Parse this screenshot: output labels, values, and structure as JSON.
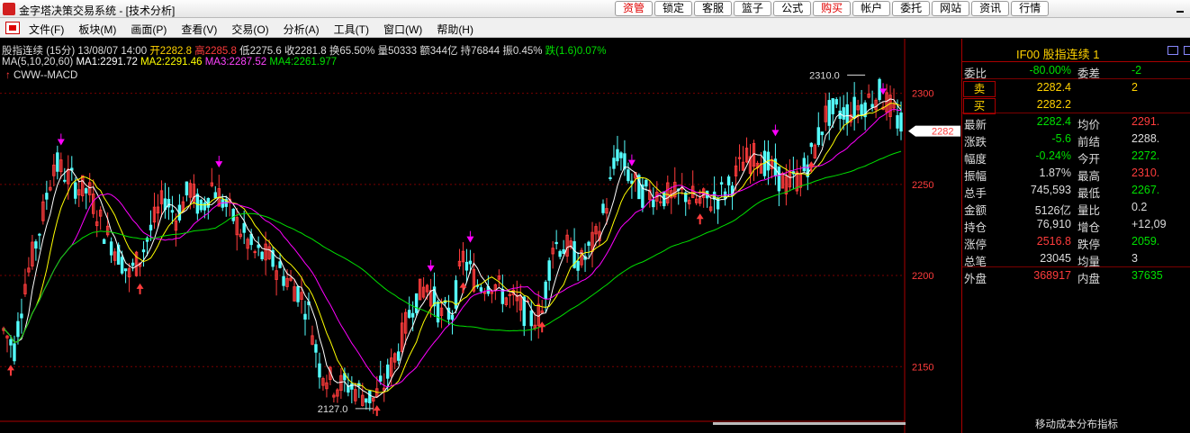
{
  "window": {
    "title": "金字塔决策交易系统 - [技术分析]"
  },
  "top_buttons": [
    {
      "label": "资管",
      "red": true
    },
    {
      "label": "锁定",
      "red": false
    },
    {
      "label": "客服",
      "red": false
    },
    {
      "label": "篮子",
      "red": false
    },
    {
      "label": "公式",
      "red": false
    },
    {
      "label": "购买",
      "red": true
    },
    {
      "label": "帐户",
      "red": false
    },
    {
      "label": "委托",
      "red": false
    },
    {
      "label": "网站",
      "red": false
    },
    {
      "label": "资讯",
      "red": false
    },
    {
      "label": "行情",
      "red": false
    }
  ],
  "menus": [
    "文件(F)",
    "板块(M)",
    "画面(P)",
    "查看(V)",
    "交易(O)",
    "分析(A)",
    "工具(T)",
    "窗口(W)",
    "帮助(H)"
  ],
  "info": {
    "name": "股指连续 (15分)",
    "datetime": "13/08/07 14:00",
    "open": "开2282.8",
    "high": "高2285.8",
    "low": "低2275.6",
    "close": "收2281.8",
    "turnover_rate": "换65.50%",
    "volume": "量50333",
    "amount": "额344亿",
    "open_interest": "持76844",
    "amplitude": "振0.45%",
    "change": "跌(1.6)0.07%",
    "ma_params": "MA(5,10,20,60)",
    "ma1": "MA1:2291.72",
    "ma2": "MA2:2291.46",
    "ma3": "MA3:2287.52",
    "ma4": "MA4:2261.977",
    "indicator": "CWW--MACD",
    "indicator_arrow": "↑"
  },
  "colors": {
    "up": "#ff3c3c",
    "down": "#54ffff",
    "ma1": "#ffffff",
    "ma2": "#ffff00",
    "ma3": "#ff00ff",
    "ma4": "#00e000",
    "grid": "#7a0000",
    "panel_green": "#00e000",
    "yellow": "#ffd200"
  },
  "chart_data": {
    "type": "candlestick",
    "x_range": [
      0,
      250
    ],
    "ylim": [
      2120,
      2325
    ],
    "yticks": [
      2150,
      2200,
      2250,
      2300
    ],
    "current_price_label": "2282",
    "annotations": [
      {
        "text": "2310.0",
        "x": 240,
        "y": 2310.0
      },
      {
        "text": "2127.0",
        "x": 103,
        "y": 2127.0
      }
    ],
    "anchors": [
      [
        0,
        2170
      ],
      [
        3,
        2160
      ],
      [
        6,
        2196
      ],
      [
        10,
        2225
      ],
      [
        14,
        2262
      ],
      [
        16,
        2258
      ],
      [
        20,
        2250
      ],
      [
        24,
        2245
      ],
      [
        28,
        2225
      ],
      [
        32,
        2212
      ],
      [
        35,
        2200
      ],
      [
        38,
        2210
      ],
      [
        42,
        2230
      ],
      [
        45,
        2243
      ],
      [
        48,
        2232
      ],
      [
        52,
        2248
      ],
      [
        55,
        2235
      ],
      [
        58,
        2250
      ],
      [
        62,
        2238
      ],
      [
        66,
        2225
      ],
      [
        70,
        2212
      ],
      [
        74,
        2210
      ],
      [
        78,
        2200
      ],
      [
        82,
        2192
      ],
      [
        85,
        2180
      ],
      [
        88,
        2150
      ],
      [
        92,
        2140
      ],
      [
        96,
        2140
      ],
      [
        100,
        2135
      ],
      [
        103,
        2132
      ],
      [
        106,
        2140
      ],
      [
        110,
        2160
      ],
      [
        114,
        2185
      ],
      [
        118,
        2195
      ],
      [
        122,
        2178
      ],
      [
        125,
        2180
      ],
      [
        128,
        2210
      ],
      [
        132,
        2195
      ],
      [
        136,
        2197
      ],
      [
        140,
        2188
      ],
      [
        143,
        2185
      ],
      [
        147,
        2176
      ],
      [
        150,
        2180
      ],
      [
        153,
        2218
      ],
      [
        157,
        2215
      ],
      [
        161,
        2207
      ],
      [
        165,
        2220
      ],
      [
        168,
        2240
      ],
      [
        171,
        2268
      ],
      [
        175,
        2252
      ],
      [
        178,
        2245
      ],
      [
        182,
        2245
      ],
      [
        186,
        2243
      ],
      [
        190,
        2245
      ],
      [
        194,
        2240
      ],
      [
        198,
        2242
      ],
      [
        202,
        2248
      ],
      [
        206,
        2262
      ],
      [
        210,
        2266
      ],
      [
        214,
        2258
      ],
      [
        218,
        2250
      ],
      [
        222,
        2254
      ],
      [
        226,
        2270
      ],
      [
        229,
        2288
      ],
      [
        232,
        2290
      ],
      [
        236,
        2290
      ],
      [
        240,
        2295
      ],
      [
        244,
        2300
      ],
      [
        247,
        2292
      ],
      [
        250,
        2282
      ]
    ],
    "buy_marks": [
      2,
      38,
      104,
      128,
      150,
      194,
      225
    ],
    "sell_marks": [
      16,
      60,
      119,
      130,
      175,
      215,
      245
    ]
  },
  "panel": {
    "code": "IF00",
    "name": "股指连续",
    "period": "1",
    "rows": [
      {
        "l1": "委比",
        "v1": "-80.00%",
        "c1": "#00e000",
        "l2": "委差",
        "v2": "-2",
        "c2": "#00e000",
        "sep": true
      },
      {
        "box": "卖",
        "v1": "2282.4",
        "c1": "#ffd200",
        "v2": "2",
        "c2": "#ffd200"
      },
      {
        "box": "买",
        "v1": "2282.2",
        "c1": "#ffd200",
        "v2": "",
        "c2": "#ffd200",
        "sep": true
      },
      {
        "l1": "最新",
        "v1": "2282.4",
        "c1": "#00e000",
        "l2": "均价",
        "v2": "2291.",
        "c2": "#ff3c3c"
      },
      {
        "l1": "涨跌",
        "v1": "-5.6",
        "c1": "#00e000",
        "l2": "前结",
        "v2": "2288.",
        "c2": "#dddddd"
      },
      {
        "l1": "幅度",
        "v1": "-0.24%",
        "c1": "#00e000",
        "l2": "今开",
        "v2": "2272.",
        "c2": "#00e000"
      },
      {
        "l1": "振幅",
        "v1": "1.87%",
        "c1": "#dddddd",
        "l2": "最高",
        "v2": "2310.",
        "c2": "#ff3c3c"
      },
      {
        "l1": "总手",
        "v1": "745,593",
        "c1": "#dddddd",
        "l2": "最低",
        "v2": "2267.",
        "c2": "#00e000"
      },
      {
        "l1": "金额",
        "v1": "5126亿",
        "c1": "#dddddd",
        "l2": "量比",
        "v2": "0.2",
        "c2": "#dddddd"
      },
      {
        "l1": "持仓",
        "v1": "76,910",
        "c1": "#dddddd",
        "l2": "增仓",
        "v2": "+12,09",
        "c2": "#dddddd"
      },
      {
        "l1": "涨停",
        "v1": "2516.8",
        "c1": "#ff3c3c",
        "l2": "跌停",
        "v2": "2059.",
        "c2": "#00e000"
      },
      {
        "l1": "总笔",
        "v1": "23045",
        "c1": "#dddddd",
        "l2": "均量",
        "v2": "3",
        "c2": "#dddddd",
        "sep": true
      },
      {
        "l1": "外盘",
        "v1": "368917",
        "c1": "#ff3c3c",
        "l2": "内盘",
        "v2": "37635",
        "c2": "#00e000"
      }
    ],
    "footer": "移动成本分布指标"
  }
}
